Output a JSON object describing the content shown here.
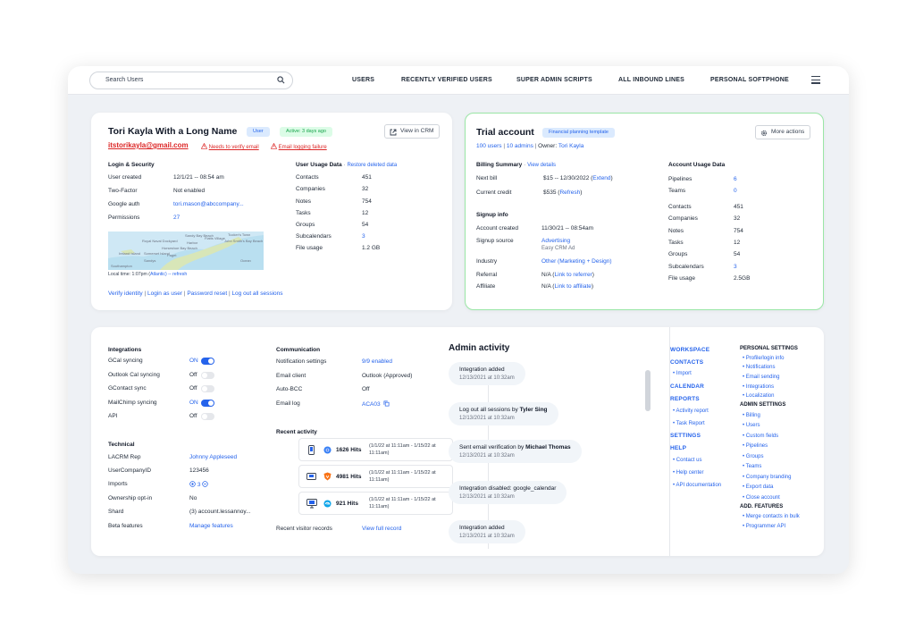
{
  "search": {
    "placeholder": "Search Users"
  },
  "nav": {
    "users": "USERS",
    "recently_verified": "RECENTLY VERIFIED USERS",
    "super_admin": "SUPER ADMIN SCRIPTS",
    "inbound": "ALL INBOUND LINES",
    "softphone": "PERSONAL SOFTPHONE"
  },
  "user": {
    "name": "Tori Kayla With a Long Name",
    "role_badge": "User",
    "active_badge": "Active: 3 days ago",
    "view_crm": "View in CRM",
    "email": "itstorikayla@gmail.com",
    "verify_warning": "Needs to verify email",
    "logging_warning": "Email logging failure"
  },
  "login": {
    "title": "Login & Security",
    "rows": [
      {
        "label": "User created",
        "value": "12/1/21 -- 08:54 am"
      },
      {
        "label": "Two-Factor",
        "value": "Not enabled"
      },
      {
        "label": "Google auth",
        "value": "tori.mason@abccompany..."
      },
      {
        "label": "Permissions",
        "value": "27"
      }
    ],
    "local_time": "Local time: 1:07pm (",
    "tz": "Atlantic",
    "refresh": ") -- refresh",
    "map_labels": [
      "Royal Naval Dockyard",
      "Sandys",
      "Southampton",
      "Somerset Island",
      "Ireland Island",
      "Sandy Bay Beach",
      "Horseshoe Bay Beach",
      "Paget",
      "Flatts Village",
      "Tucker's Town",
      "John Smith's Bay Beach",
      "Harbor",
      "Ocean"
    ]
  },
  "usage": {
    "title": "User Usage Data",
    "restore": "Restore deleted data",
    "rows": [
      {
        "label": "Contacts",
        "value": "451"
      },
      {
        "label": "Companies",
        "value": "32"
      },
      {
        "label": "Notes",
        "value": "754"
      },
      {
        "label": "Tasks",
        "value": "12"
      },
      {
        "label": "Groups",
        "value": "54"
      },
      {
        "label": "Subcalendars",
        "value": "3"
      },
      {
        "label": "File usage",
        "value": "1.2 GB"
      }
    ]
  },
  "actions": {
    "verify": "Verify identity",
    "login_as": "Login as user",
    "reset": "Password reset",
    "logout": "Log out all sessions"
  },
  "account": {
    "title": "Trial account",
    "template_badge": "Financial planning template",
    "more_actions": "More actions",
    "users": "100 users",
    "admins": "10 admins",
    "owner_label": "Owner:",
    "owner": "Tori Kayla",
    "billing_title": "Billing Summary",
    "view_details": "View details",
    "next_bill_label": "Next bill",
    "next_bill": "$15 -- 12/30/2022 (",
    "extend": "Extend",
    "close_paren": ")",
    "credit_label": "Current credit",
    "credit": "$535 (",
    "refresh": "Refresh",
    "signup_title": "Signup info",
    "created_label": "Account created",
    "created": "11/30/21 -- 08:54am",
    "source_label": "Signup source",
    "source": "Advertising",
    "source_sub": "Easy CRM Ad",
    "industry_label": "Industry",
    "industry": "Other (Marketing + Design)",
    "referral_label": "Referral",
    "referral": "N/A (",
    "referral_link": "Link to referrer",
    "affiliate_label": "Affiliate",
    "affiliate": "N/A (",
    "affiliate_link": "Link to affiliate",
    "usage_title": "Account Usage Data",
    "usage_rows": [
      {
        "label": "Pipelines",
        "value": "6"
      },
      {
        "label": "Teams",
        "value": "0"
      },
      {
        "label": "Contacts",
        "value": "451"
      },
      {
        "label": "Companies",
        "value": "32"
      },
      {
        "label": "Notes",
        "value": "754"
      },
      {
        "label": "Tasks",
        "value": "12"
      },
      {
        "label": "Groups",
        "value": "54"
      },
      {
        "label": "Subcalendars",
        "value": "3"
      },
      {
        "label": "File usage",
        "value": "2.5GB"
      }
    ]
  },
  "integrations": {
    "title": "Integrations",
    "rows": [
      {
        "label": "GCal syncing",
        "value": "ON",
        "on": true
      },
      {
        "label": "Outlook Cal syncing",
        "value": "Off",
        "on": false
      },
      {
        "label": "GContact sync",
        "value": "Off",
        "on": false
      },
      {
        "label": "MailChimp syncing",
        "value": "ON",
        "on": true
      },
      {
        "label": "API",
        "value": "Off",
        "on": false
      }
    ]
  },
  "technical": {
    "title": "Technical",
    "rows": [
      {
        "label": "LACRM Rep",
        "value": "Johnny Appleseed"
      },
      {
        "label": "UserCompanyID",
        "value": "123456"
      },
      {
        "label": "Imports",
        "value": "3"
      },
      {
        "label": "Ownership opt-in",
        "value": "No"
      },
      {
        "label": "Shard",
        "value": "(3) account.lessannoy..."
      },
      {
        "label": "Beta features",
        "value": "Manage features"
      }
    ]
  },
  "communication": {
    "title": "Communication",
    "rows": [
      {
        "label": "Notification settings",
        "value": "9/9 enabled"
      },
      {
        "label": "Email client",
        "value": "Outlook (Approved)"
      },
      {
        "label": "Auto-BCC",
        "value": "Off"
      },
      {
        "label": "Email log",
        "value": "ACA03"
      }
    ]
  },
  "recent": {
    "title": "Recent activity",
    "items": [
      {
        "hits": "1626 Hits",
        "range": "(1/1/22 at 11:11am - 1/15/22 at 11:11am)"
      },
      {
        "hits": "4981 Hits",
        "range": "(1/1/22 at 11:11am - 1/15/22 at 11:11am)"
      },
      {
        "hits": "921 Hits",
        "range": "(1/1/22 at 11:11am - 1/15/22 at 11:11am)"
      }
    ],
    "visitor_label": "Recent visitor records",
    "visitor_link": "View full record"
  },
  "admin": {
    "title": "Admin activity",
    "items": [
      {
        "prefix": "Integration added",
        "who": "",
        "date": "12/13/2021 at 10:32am"
      },
      {
        "prefix": "Log out all sessions by ",
        "who": "Tyler Sing",
        "date": "12/13/2021 at 10:32am"
      },
      {
        "prefix": "Sent email verification by ",
        "who": "Michael Thomas",
        "date": "12/13/2021 at 10:32am"
      },
      {
        "prefix": "Integration disabled: google_calendar",
        "who": "",
        "date": "12/13/2021 at 10:32am"
      },
      {
        "prefix": "Integration added",
        "who": "",
        "date": "12/13/2021 at 10:32am"
      }
    ]
  },
  "sidenav": {
    "workspace": "WORKSPACE",
    "contacts": "CONTACTS",
    "import": "Import",
    "calendar": "CALENDAR",
    "reports": "REPORTS",
    "activity_report": "Activity report",
    "task_report": "Task Report",
    "settings": "SETTINGS",
    "help": "HELP",
    "contact_us": "Contact us",
    "help_center": "Help center",
    "api_docs": "API documentation"
  },
  "personal": {
    "title": "PERSONAL SETTINGS",
    "items": [
      "Profile/login info",
      "Notifications",
      "Email sending",
      "Integrations",
      "Localization"
    ]
  },
  "adminset": {
    "title": "ADMIN SETTINGS",
    "items": [
      "Billing",
      "Users",
      "Custom fields",
      "Pipelines",
      "Groups",
      "Teams",
      "Company branding",
      "Export data",
      "Close account"
    ]
  },
  "addfeat": {
    "title": "ADD. FEATURES",
    "items": [
      "Merge contacts in bulk",
      "Programmer API"
    ]
  },
  "colors": {
    "accent": "#2563eb",
    "success_border": "#9ae6a6",
    "danger": "#dc2626"
  }
}
